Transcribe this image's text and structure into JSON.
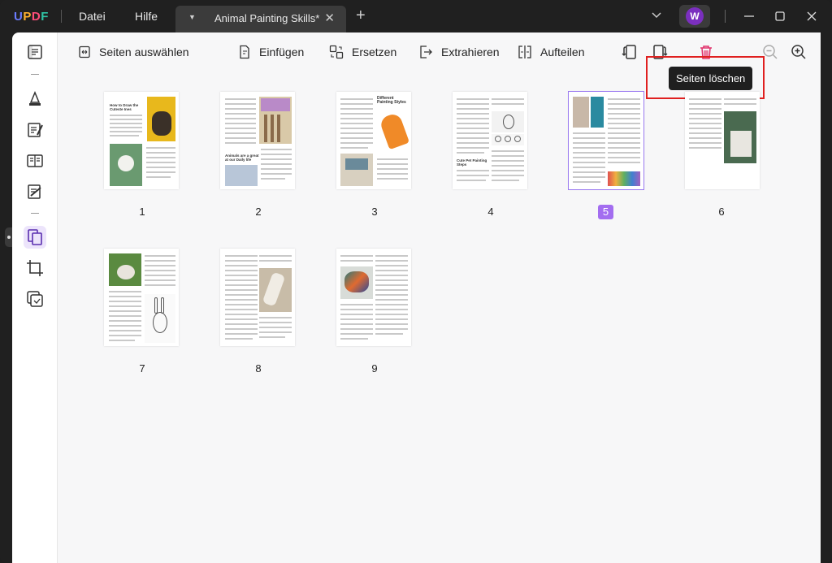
{
  "titlebar": {
    "logo_letters": [
      "U",
      "P",
      "D",
      "F"
    ],
    "logo_colors": [
      "#6b7cff",
      "#ffb02e",
      "#ff4d7a",
      "#2fc5a5"
    ],
    "menu": [
      "Datei",
      "Hilfe"
    ],
    "tab_title": "Animal Painting Skills*",
    "avatar_letter": "W"
  },
  "toolbar": {
    "select_pages": "Seiten auswählen",
    "insert": "Einfügen",
    "replace": "Ersetzen",
    "extract": "Extrahieren",
    "split": "Aufteilen",
    "tooltip": "Seiten löschen"
  },
  "pages": [
    {
      "number": "1"
    },
    {
      "number": "2"
    },
    {
      "number": "3"
    },
    {
      "number": "4"
    },
    {
      "number": "5",
      "selected": true
    },
    {
      "number": "6"
    },
    {
      "number": "7"
    },
    {
      "number": "8"
    },
    {
      "number": "9"
    }
  ],
  "thumb_headings": {
    "p1": "How to Draw the Cuteste Ines",
    "p2": "Animals are a great at our Daily life",
    "p3": "Different Painting Styles",
    "p4": "Cute Pet Painting Steps"
  },
  "colors": {
    "accent": "#a36df0",
    "highlight": "#e02020",
    "delete": "#e0306a"
  }
}
